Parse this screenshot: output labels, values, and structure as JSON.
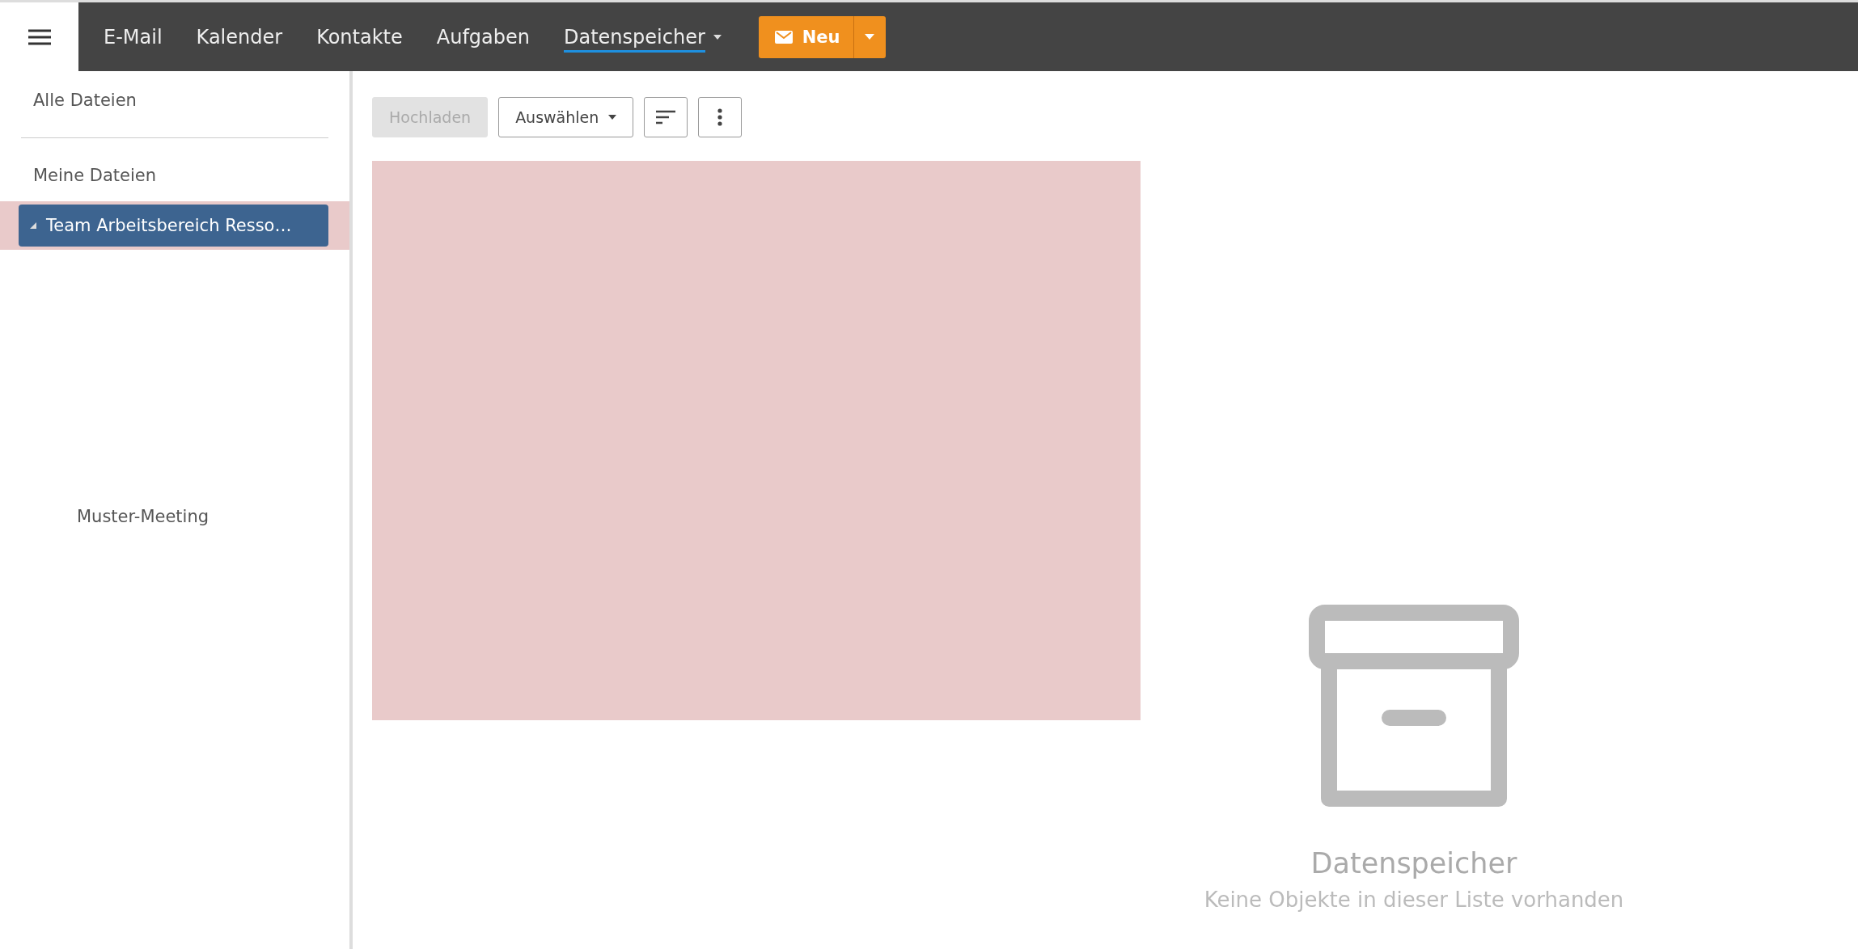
{
  "topbar": {
    "nav": [
      {
        "label": "E-Mail",
        "selected": false,
        "dropdown": false
      },
      {
        "label": "Kalender",
        "selected": false,
        "dropdown": false
      },
      {
        "label": "Kontakte",
        "selected": false,
        "dropdown": false
      },
      {
        "label": "Aufgaben",
        "selected": false,
        "dropdown": false
      },
      {
        "label": "Datenspeicher",
        "selected": true,
        "dropdown": true
      }
    ],
    "new_button": {
      "label": "Neu"
    }
  },
  "sidebar": {
    "sections": [
      [
        {
          "label": "Alle Dateien",
          "selected": false
        }
      ],
      [
        {
          "label": "Meine Dateien",
          "selected": false
        },
        {
          "label": "Team Arbeitsbereich Resso…",
          "selected": true,
          "expanded": true,
          "children": [
            {
              "label": "Muster-Meeting",
              "selected": false
            }
          ]
        }
      ]
    ]
  },
  "toolbar": {
    "buttons": [
      {
        "kind": "text",
        "label": "Hochladen",
        "disabled": true
      },
      {
        "kind": "dropdown",
        "label": "Auswählen",
        "disabled": false
      },
      {
        "kind": "sort",
        "disabled": false
      },
      {
        "kind": "more",
        "disabled": false
      }
    ]
  },
  "empty_state": {
    "title": "Datenspeicher",
    "message": "Keine Objekte in dieser Liste vorhanden"
  }
}
